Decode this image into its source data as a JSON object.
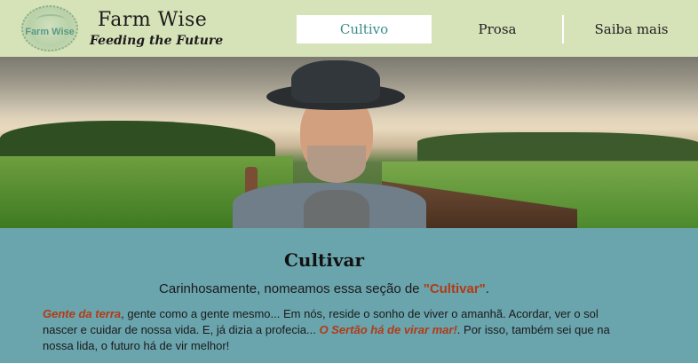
{
  "brand": {
    "logo_text": "Farm Wise",
    "title": "Farm Wise",
    "subtitle": "Feeding the Future"
  },
  "nav": {
    "tabs": [
      {
        "label": "Cultivo",
        "active": true
      },
      {
        "label": "Prosa",
        "active": false
      },
      {
        "label": "Saiba mais",
        "active": false
      }
    ]
  },
  "section": {
    "title": "Cultivar",
    "intro_prefix": "Carinhosamente, nomeamos essa seção de ",
    "intro_highlight": "\"Cultivar\"",
    "intro_suffix": ".",
    "body": {
      "lead_accent": "Gente da terra",
      "part1": ", gente como a gente mesmo... Em nós, reside o sonho de viver o amanhã. Acordar, ver o sol nascer e cuidar de nossa vida. E, já dizia a profecia... ",
      "quote_accent": "O Sertão há de virar mar!",
      "part2": ". Por isso, também sei que na nossa lida, o futuro há de vir melhor!"
    }
  },
  "colors": {
    "header_bg": "#d6e2b8",
    "content_bg": "#6aa4ad",
    "accent": "#b33a14",
    "active_tab_text": "#3b8d8b"
  }
}
